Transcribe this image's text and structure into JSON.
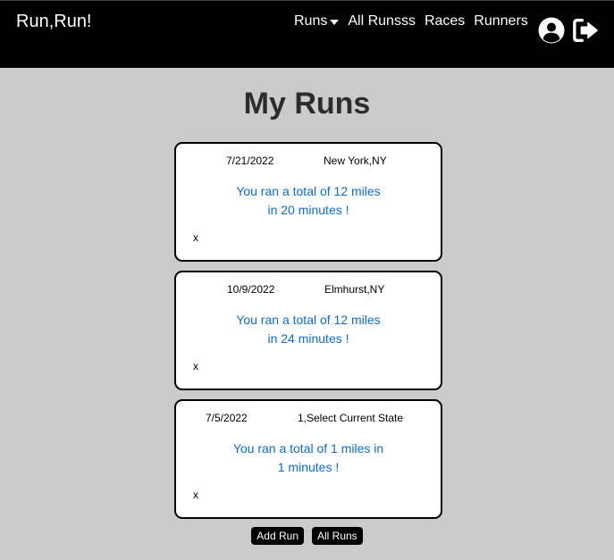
{
  "nav": {
    "brand": "Run,Run!",
    "links": {
      "runs": "Runs",
      "all_runs": "All Runsss",
      "races": "Races",
      "runners": "Runners"
    },
    "icons": {
      "profile": "user-circle-icon",
      "logout": "sign-out-icon"
    }
  },
  "page": {
    "title": "My Runs"
  },
  "runs": [
    {
      "date": "7/21/2022",
      "location": "New York,NY",
      "summary_line1": "You ran a total of 12 miles",
      "summary_line2": "in 20 minutes !",
      "delete_label": "x"
    },
    {
      "date": "10/9/2022",
      "location": "Elmhurst,NY",
      "summary_line1": "You ran a total of 12 miles",
      "summary_line2": "in 24 minutes !",
      "delete_label": "x"
    },
    {
      "date": "7/5/2022",
      "location": "1,Select Current State",
      "summary_line1": "You ran a total of 1 miles in",
      "summary_line2": "1 minutes !",
      "delete_label": "x"
    }
  ],
  "actions": {
    "add_run": "Add Run",
    "all_runs": "All Runs"
  },
  "colors": {
    "navbar_bg": "#000000",
    "page_bg": "#cbcbcb",
    "summary_text": "#0b6cd6"
  }
}
